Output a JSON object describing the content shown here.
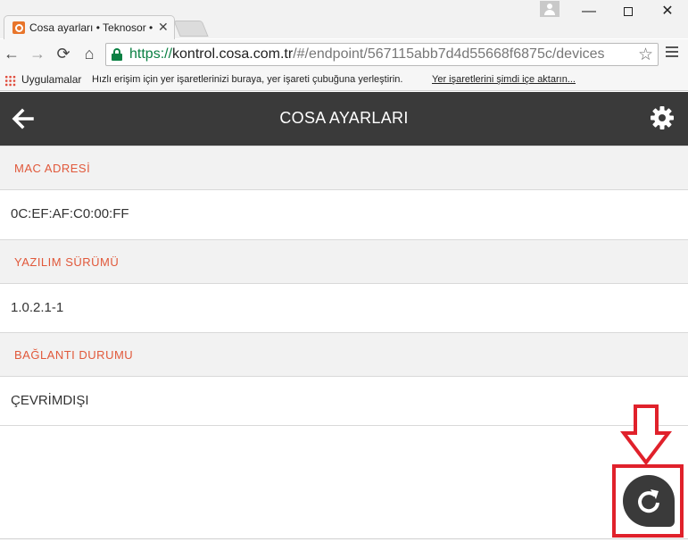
{
  "browser": {
    "tab_title": "Cosa ayarları • Teknosor •",
    "tab_close": "✕",
    "window_controls": {
      "minimize": "—",
      "close": "✕"
    },
    "url": {
      "scheme": "https://",
      "host": "kontrol.cosa.com.tr",
      "path": "/#/endpoint/567115abb7d4d55668f6875c/devices"
    },
    "nav": {
      "back": "←",
      "forward": "→",
      "reload": "⟳",
      "home": "⌂"
    },
    "star": "☆",
    "bookmarks": {
      "apps_label": "Uygulamalar",
      "hint_text": "Hızlı erişim için yer işaretlerinizi buraya, yer işareti çubuğuna yerleştirin.",
      "import_link": "Yer işaretlerini şimdi içe aktarın..."
    }
  },
  "app": {
    "header_title": "COSA AYARLARI",
    "sections": [
      {
        "label": "MAC ADRESİ",
        "value": "0C:EF:AF:C0:00:FF"
      },
      {
        "label": "YAZILIM SÜRÜMÜ",
        "value": "1.0.2.1-1"
      },
      {
        "label": "BAĞLANTI DURUMU",
        "value": "ÇEVRİMDIŞI"
      }
    ]
  },
  "colors": {
    "header_bg": "#3a3a3a",
    "section_label": "#e1583a",
    "annotation_red": "#e0212b",
    "url_secure": "#0b8043"
  },
  "icons": [
    "back-arrow-icon",
    "gear-icon",
    "refresh-icon",
    "lock-icon",
    "star-icon",
    "apps-grid-icon"
  ]
}
